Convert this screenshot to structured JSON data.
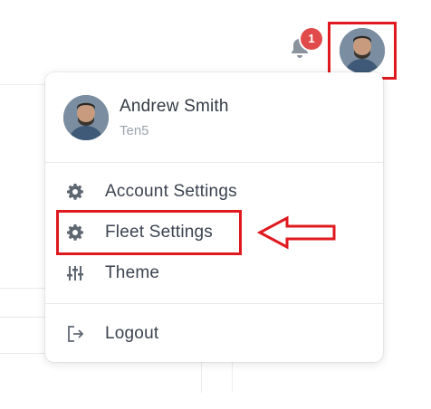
{
  "topbar": {
    "notification_count": "1",
    "notification_icon": "bell-icon",
    "avatar_icon": "user-avatar"
  },
  "profile": {
    "name": "Andrew Smith",
    "organization": "Ten5"
  },
  "menu": {
    "items": [
      {
        "label": "Account Settings",
        "icon": "gear-icon"
      },
      {
        "label": "Fleet Settings",
        "icon": "gear-icon"
      },
      {
        "label": "Theme",
        "icon": "sliders-icon"
      },
      {
        "label": "Logout",
        "icon": "logout-icon"
      }
    ]
  },
  "colors": {
    "annotation": "#e0191f",
    "badge": "#e14a4a",
    "text": "#3b4350",
    "muted": "#9aa3ad"
  }
}
